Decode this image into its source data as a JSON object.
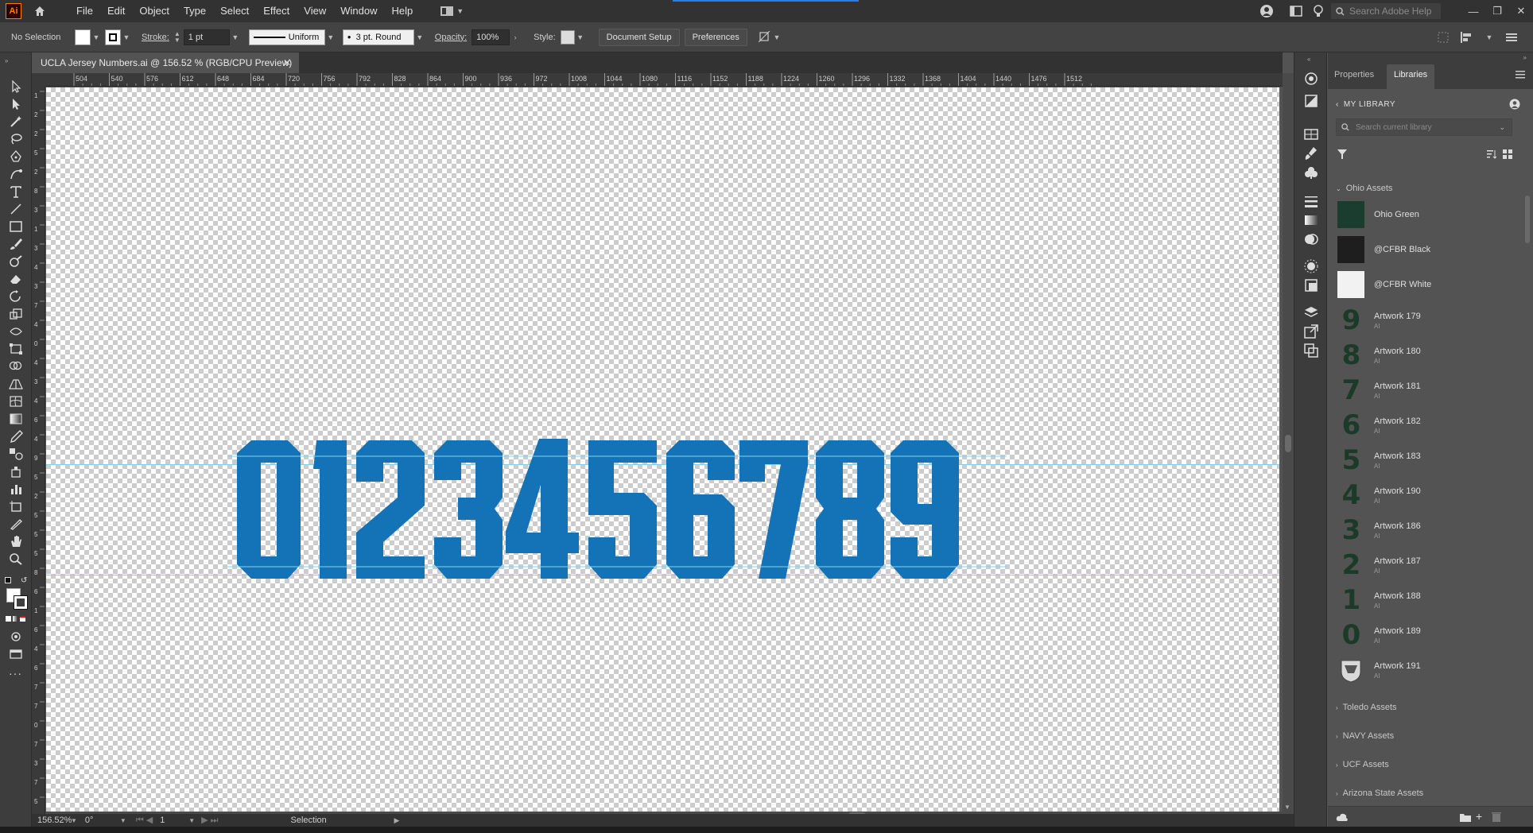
{
  "app": {
    "logo": "Ai"
  },
  "menu": [
    "File",
    "Edit",
    "Object",
    "Type",
    "Select",
    "Effect",
    "View",
    "Window",
    "Help"
  ],
  "search_adobe": {
    "placeholder": "Search Adobe Help"
  },
  "control_bar": {
    "selection": "No Selection",
    "stroke_label": "Stroke:",
    "stroke_value": "1 pt",
    "profile": "Uniform",
    "brush": "3 pt. Round",
    "opacity_label": "Opacity:",
    "opacity_value": "100%",
    "style_label": "Style:",
    "document_setup": "Document Setup",
    "preferences": "Preferences"
  },
  "document_tab": {
    "title": "UCLA Jersey Numbers.ai @ 156.52 % (RGB/CPU Preview)"
  },
  "ruler_h": [
    "504",
    "540",
    "576",
    "612",
    "648",
    "684",
    "720",
    "756",
    "792",
    "828",
    "864",
    "900",
    "936",
    "972",
    "1008",
    "1044",
    "1080",
    "1116",
    "1152",
    "1188",
    "1224",
    "1260",
    "1296",
    "1332",
    "1368",
    "1404",
    "1440",
    "1476",
    "1512"
  ],
  "ruler_v": [
    "1",
    "2",
    "2",
    "5",
    "2",
    "8",
    "3",
    "1",
    "3",
    "4",
    "3",
    "7",
    "4",
    "0",
    "4",
    "3",
    "4",
    "6",
    "4",
    "9",
    "5",
    "2",
    "5",
    "5",
    "5",
    "8",
    "6",
    "1",
    "6",
    "4",
    "6",
    "7",
    "7",
    "0",
    "7",
    "3",
    "7",
    "5"
  ],
  "artwork": {
    "text": "0123456789",
    "color": "#1473b7",
    "guide_color": "#7fd3ee"
  },
  "status_bar": {
    "zoom": "156.52%",
    "rotation": "0°",
    "artboard": "1",
    "tool": "Selection"
  },
  "panel": {
    "tabs": [
      "Properties",
      "Libraries"
    ],
    "active_tab": "Libraries",
    "library_name": "MY LIBRARY",
    "search_placeholder": "Search current library",
    "group_open": "Ohio Assets",
    "colors": [
      {
        "name": "Ohio Green",
        "hex": "#1a3d2f"
      },
      {
        "name": "@CFBR Black",
        "hex": "#1e1e1e"
      },
      {
        "name": "@CFBR White",
        "hex": "#f2f2f2"
      }
    ],
    "artworks": [
      {
        "digit": "9",
        "name": "Artwork 179",
        "type": "AI"
      },
      {
        "digit": "8",
        "name": "Artwork 180",
        "type": "AI"
      },
      {
        "digit": "7",
        "name": "Artwork 181",
        "type": "AI"
      },
      {
        "digit": "6",
        "name": "Artwork 182",
        "type": "AI"
      },
      {
        "digit": "5",
        "name": "Artwork 183",
        "type": "AI"
      },
      {
        "digit": "4",
        "name": "Artwork 190",
        "type": "AI"
      },
      {
        "digit": "3",
        "name": "Artwork 186",
        "type": "AI"
      },
      {
        "digit": "2",
        "name": "Artwork 187",
        "type": "AI"
      },
      {
        "digit": "1",
        "name": "Artwork 188",
        "type": "AI"
      },
      {
        "digit": "0",
        "name": "Artwork 189",
        "type": "AI"
      },
      {
        "digit": "",
        "name": "Artwork 191",
        "type": "AI"
      }
    ],
    "collapsed_groups": [
      "Toledo Assets",
      "NAVY Assets",
      "UCF Assets",
      "Arizona State Assets"
    ]
  }
}
